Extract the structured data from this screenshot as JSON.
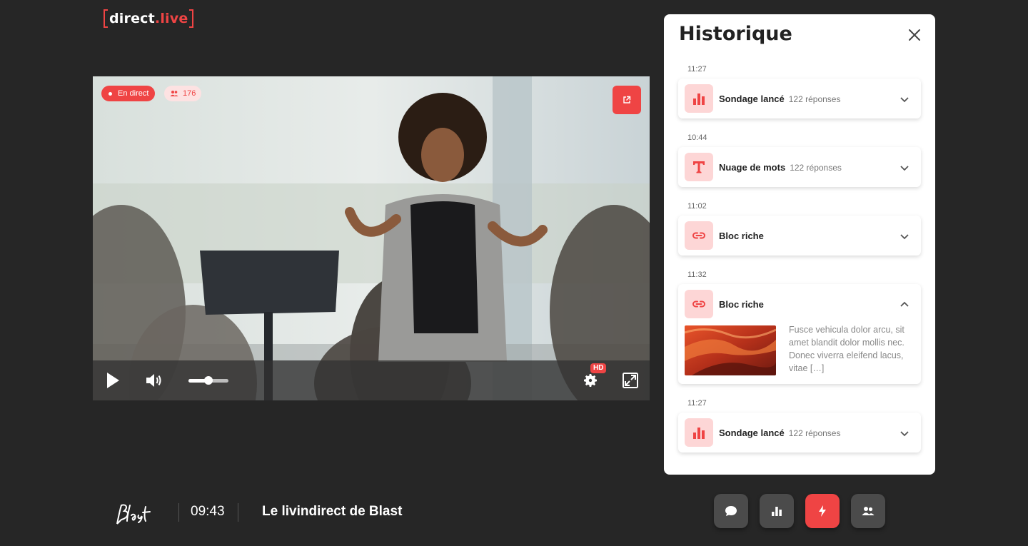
{
  "logo": {
    "part1": "direct",
    "dot": ".",
    "part2": "live"
  },
  "video": {
    "live_badge": "En direct",
    "viewer_count": "176",
    "hd_label": "HD",
    "volume_level_percent": 50
  },
  "footer": {
    "time": "09:43",
    "title": "Le livindirect de Blast"
  },
  "history": {
    "title": "Historique",
    "items": [
      {
        "time": "11:27",
        "label": "Sondage lancé",
        "sub": "122 réponses",
        "icon": "bar-chart-icon",
        "expanded": false
      },
      {
        "time": "10:44",
        "label": "Nuage de mots",
        "sub": "122 réponses",
        "icon": "text-t-icon",
        "expanded": false
      },
      {
        "time": "11:02",
        "label": "Bloc riche",
        "sub": "",
        "icon": "link-icon",
        "expanded": false
      },
      {
        "time": "11:32",
        "label": "Bloc riche",
        "sub": "",
        "icon": "link-icon",
        "expanded": true,
        "description": "Fusce vehicula dolor arcu, sit amet blandit dolor mollis nec. Donec viverra eleifend lacus, vitae […]"
      },
      {
        "time": "11:27",
        "label": "Sondage lancé",
        "sub": "122 réponses",
        "icon": "bar-chart-icon",
        "expanded": false
      }
    ]
  },
  "colors": {
    "accent": "#ef4444",
    "background": "#262626",
    "tool_bg": "#4b4b4b",
    "icon_bg": "#fdd6d6"
  },
  "toolbar": {
    "items": [
      {
        "icon": "chat-icon",
        "active": false
      },
      {
        "icon": "bar-chart-icon",
        "active": false
      },
      {
        "icon": "lightning-icon",
        "active": true
      },
      {
        "icon": "users-icon",
        "active": false
      }
    ]
  }
}
